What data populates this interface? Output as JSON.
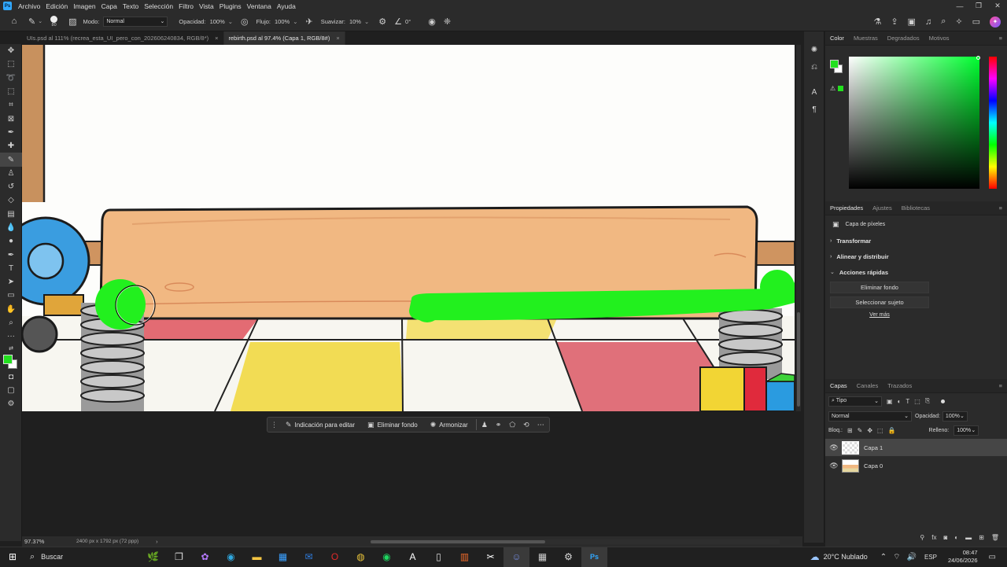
{
  "menubar": {
    "app_icon": "Ps",
    "items": [
      "Archivo",
      "Edición",
      "Imagen",
      "Capa",
      "Texto",
      "Selección",
      "Filtro",
      "Vista",
      "Plugins",
      "Ventana",
      "Ayuda"
    ]
  },
  "options": {
    "brush_size": "80",
    "mode_label": "Modo:",
    "mode_value": "Normal",
    "opacity_label": "Opacidad:",
    "opacity_value": "100%",
    "flow_label": "Flujo:",
    "flow_value": "100%",
    "smoothing_label": "Suavizar:",
    "smoothing_value": "10%",
    "angle_value": "0°"
  },
  "tabs": [
    {
      "label": "UIs.psd al 111% (recrea_esta_UI_pero_con_202606240834, RGB/8*)",
      "active": false
    },
    {
      "label": "rebirth.psd al 97.4% (Capa 1, RGB/8#)",
      "active": true
    }
  ],
  "status": {
    "zoom": "97.37%",
    "doc_size": "2400 px x 1792 px (72 ppp)"
  },
  "contextbar": {
    "hint": "Indicación para editar",
    "remove_bg": "Eliminar fondo",
    "harmonize": "Armonizar"
  },
  "color_panel": {
    "tabs": [
      "Color",
      "Muestras",
      "Degradados",
      "Motivos"
    ],
    "foreground": "#22e01e",
    "background": "#ffffff"
  },
  "properties": {
    "tabs": [
      "Propiedades",
      "Ajustes",
      "Bibliotecas"
    ],
    "layer_type": "Capa de píxeles",
    "sections": [
      "Transformar",
      "Alinear y distribuir",
      "Acciones rápidas"
    ],
    "btn_remove_bg": "Eliminar fondo",
    "btn_select_subject": "Seleccionar sujeto",
    "more": "Ver más"
  },
  "layers_panel": {
    "tabs": [
      "Capas",
      "Canales",
      "Trazados"
    ],
    "filter": "Tipo",
    "blend": "Normal",
    "opacity_label": "Opacidad:",
    "opacity_value": "100%",
    "lock_label": "Bloq.:",
    "fill_label": "Relleno:",
    "fill_value": "100%",
    "layers": [
      {
        "name": "Capa 1",
        "selected": true
      },
      {
        "name": "Capa 0",
        "selected": false
      }
    ]
  },
  "taskbar": {
    "search": "Buscar",
    "weather": "20°C Nublado",
    "lang": "ESP",
    "time": "08:47",
    "date": "24/06/2026"
  }
}
